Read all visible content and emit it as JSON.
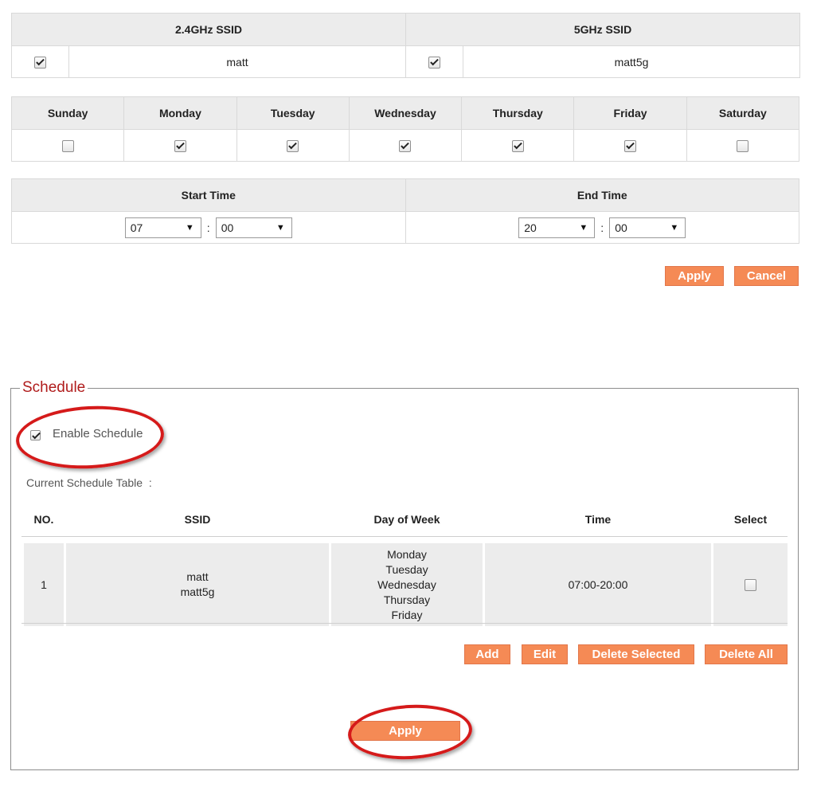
{
  "ssid": {
    "header_24": "2.4GHz SSID",
    "header_5": "5GHz SSID",
    "name_24": "matt",
    "name_5": "matt5g",
    "checked_24": true,
    "checked_5": true
  },
  "days": [
    {
      "label": "Sunday",
      "checked": false
    },
    {
      "label": "Monday",
      "checked": true
    },
    {
      "label": "Tuesday",
      "checked": true
    },
    {
      "label": "Wednesday",
      "checked": true
    },
    {
      "label": "Thursday",
      "checked": true
    },
    {
      "label": "Friday",
      "checked": true
    },
    {
      "label": "Saturday",
      "checked": false
    }
  ],
  "time": {
    "start_label": "Start Time",
    "end_label": "End Time",
    "start_hour": "07",
    "start_min": "00",
    "end_hour": "20",
    "end_min": "00",
    "separator": ":"
  },
  "top_actions": {
    "apply": "Apply",
    "cancel": "Cancel"
  },
  "schedule": {
    "legend": "Schedule",
    "enable_label": "Enable Schedule",
    "enable_checked": true,
    "table_label": "Current Schedule Table  :",
    "columns": [
      "NO.",
      "SSID",
      "Day of Week",
      "Time",
      "Select"
    ],
    "rows": [
      {
        "no": "1",
        "ssids": [
          "matt",
          "matt5g"
        ],
        "days": [
          "Monday",
          "Tuesday",
          "Wednesday",
          "Thursday",
          "Friday"
        ],
        "time": "07:00-20:00",
        "selected": false
      }
    ],
    "buttons": {
      "add": "Add",
      "edit": "Edit",
      "delete_selected": "Delete Selected",
      "delete_all": "Delete All",
      "apply": "Apply"
    }
  },
  "colors": {
    "button": "#f58a55",
    "legend": "#b01c1c",
    "highlight_ring": "#d51a1a",
    "header_bg": "#ececec"
  }
}
